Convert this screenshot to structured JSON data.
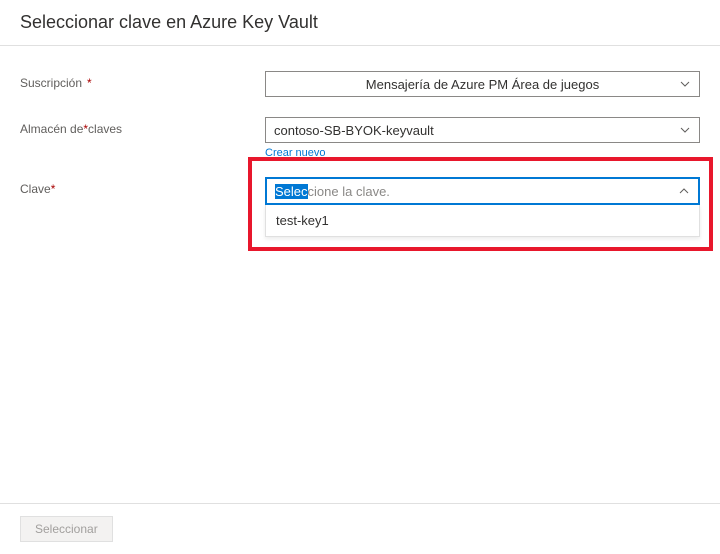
{
  "header": {
    "title": "Seleccionar clave en Azure Key Vault"
  },
  "form": {
    "subscription": {
      "label": "Suscripción",
      "required": "*",
      "value": "Mensajería de Azure PM Área de juegos"
    },
    "keyvault": {
      "label": "Almacén de",
      "required": "*",
      "label_suffix": "claves",
      "value": "contoso-SB-BYOK-keyvault",
      "create_link": "Crear nuevo"
    },
    "key": {
      "label": "Clave",
      "required": "*",
      "placeholder_selected": "Selec",
      "placeholder_rest": "cione la clave.",
      "options": [
        "test-key1"
      ]
    }
  },
  "footer": {
    "select_button": "Seleccionar"
  }
}
